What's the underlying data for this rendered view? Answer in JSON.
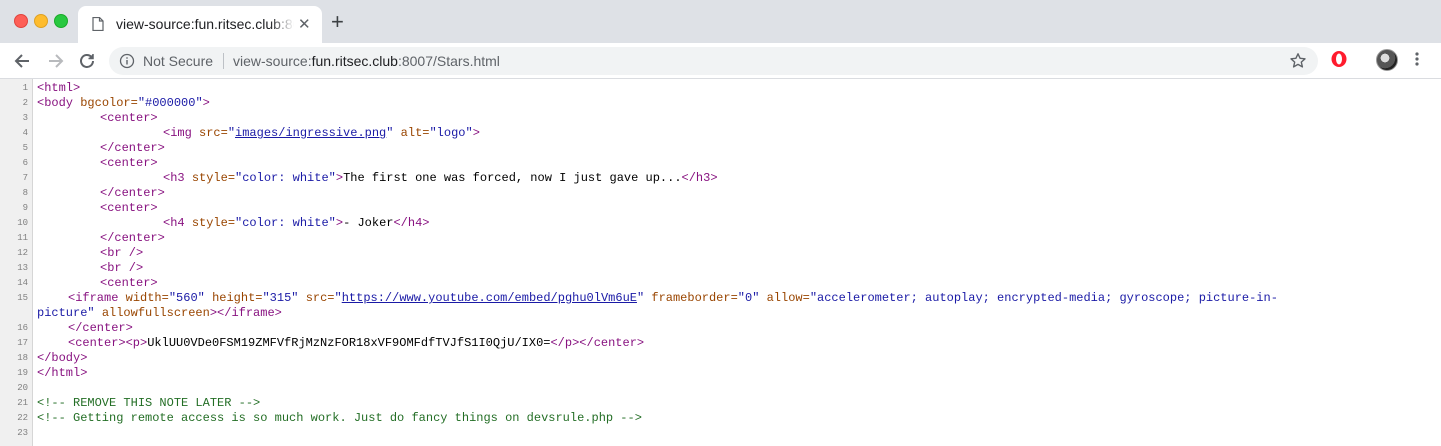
{
  "window": {
    "title": "view-source:fun.ritsec.club:8007/Stars.html"
  },
  "tab": {
    "title": "view-source:fun.ritsec.club:8007/Stars.html",
    "close": "✕"
  },
  "new_tab": "+",
  "address_bar": {
    "security_label": "Not Secure",
    "scheme": "view-source:",
    "host": "fun.ritsec.club",
    "rest": ":8007/Stars.html"
  },
  "icons": {
    "back": "arrow-left-icon",
    "forward": "arrow-right-icon",
    "reload": "reload-icon",
    "info": "info-icon",
    "star": "star-icon",
    "opera": "opera-icon",
    "menu": "menu-dots-icon"
  },
  "colors": {
    "tag": "#881280",
    "attr": "#994500",
    "value": "#1a1aa6",
    "comment": "#236e25"
  },
  "source": {
    "line_numbers": [
      "1",
      "2",
      "3",
      "4",
      "5",
      "6",
      "7",
      "8",
      "9",
      "10",
      "11",
      "12",
      "13",
      "14",
      "15",
      "16",
      "17",
      "18",
      "19",
      "20",
      "21",
      "22",
      "23"
    ],
    "l1": {
      "t1": "<html>"
    },
    "l2": {
      "t1": "<body",
      "a1": "bgcolor=",
      "v1": "\"#000000\"",
      "t2": ">"
    },
    "l3": {
      "t1": "<center>"
    },
    "l4": {
      "t1": "<img",
      "a1": "src=",
      "q1": "\"",
      "u1": "images/ingressive.png",
      "q2": "\"",
      "a2": "alt=",
      "v2": "\"logo\"",
      "t2": ">"
    },
    "l5": {
      "t1": "</center>"
    },
    "l6": {
      "t1": "<center>"
    },
    "l7": {
      "t1": "<h3",
      "a1": "style=",
      "v1": "\"color: white\"",
      "t2": ">",
      "text": "The first one was forced, now I just gave up...",
      "t3": "</h3>"
    },
    "l8": {
      "t1": "</center>"
    },
    "l9": {
      "t1": "<center>"
    },
    "l10": {
      "t1": "<h4",
      "a1": "style=",
      "v1": "\"color: white\"",
      "t2": ">",
      "text": "- Joker",
      "t3": "</h4>"
    },
    "l11": {
      "t1": "</center>"
    },
    "l12": {
      "t1": "<br />"
    },
    "l13": {
      "t1": "<br />"
    },
    "l14": {
      "t1": "<center>"
    },
    "l15": {
      "t1": "<iframe",
      "a1": "width=",
      "v1": "\"560\"",
      "a2": "height=",
      "v2": "\"315\"",
      "a3": "src=",
      "q1": "\"",
      "u1": "https://www.youtube.com/embed/pghu0lVm6uE",
      "q2": "\"",
      "a4": "frameborder=",
      "v4": "\"0\"",
      "a5": "allow=",
      "v5a": "\"accelerometer; autoplay; encrypted-media; gyroscope; picture-in-",
      "v5b": "picture\"",
      "a6": "allowfullscreen",
      "t2": "></iframe>"
    },
    "l16": {
      "t1": "</center>"
    },
    "l17": {
      "t1": "<center><p>",
      "text": "UklUU0VDe0FSM19ZMFVfRjMzNzFOR18xVF9OMFdfTVJfS1I0QjU/IX0=",
      "t2": "</p></center>"
    },
    "l18": {
      "t1": "</body>"
    },
    "l19": {
      "t1": "</html>"
    },
    "l21": {
      "c1": "<!-- REMOVE THIS NOTE LATER -->"
    },
    "l22": {
      "c1": "<!-- Getting remote access is so much work. Just do fancy things on devsrule.php -->"
    }
  }
}
